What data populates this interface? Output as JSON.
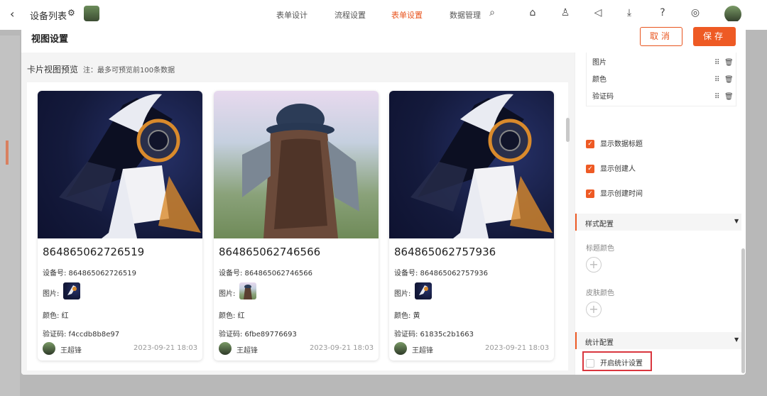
{
  "app": {
    "back_icon": "chevron-left-icon",
    "title": "设备列表",
    "nav": [
      "表单设计",
      "流程设置",
      "表单设置",
      "数据管理"
    ],
    "active_nav": "表单设置",
    "toolbar_icons": [
      "search-icon",
      "home-icon",
      "shirt-icon",
      "megaphone-icon",
      "download-icon",
      "help-icon",
      "settings-icon"
    ]
  },
  "dialog": {
    "title": "视图设置",
    "cancel_label": "取消",
    "save_label": "保存",
    "preview_title": "卡片视图预览",
    "preview_note": "注：最多可预览前100条数据",
    "cards": [
      {
        "title": "864865062726519",
        "device_no": "设备号: 864865062726519",
        "image_label": "图片:",
        "color": "颜色: 红",
        "code": "验证码: f4ccdb8b8e97",
        "user": "王超锋",
        "time": "2023-09-21 18:03"
      },
      {
        "title": "864865062746566",
        "device_no": "设备号: 864865062746566",
        "image_label": "图片:",
        "color": "颜色: 红",
        "code": "验证码: 6fbe89776693",
        "user": "王超锋",
        "time": "2023-09-21 18:03"
      },
      {
        "title": "864865062757936",
        "device_no": "设备号: 864865062757936",
        "image_label": "图片:",
        "color": "颜色: 黄",
        "code": "验证码: 61835c2b1663",
        "user": "王超锋",
        "time": "2023-09-21 18:03"
      }
    ],
    "fields": [
      "图片",
      "颜色",
      "验证码"
    ],
    "checks": [
      {
        "label": "显示数据标题",
        "checked": true
      },
      {
        "label": "显示创建人",
        "checked": true
      },
      {
        "label": "显示创建时间",
        "checked": true
      }
    ],
    "style_section": "样式配置",
    "title_color_label": "标题颜色",
    "skin_color_label": "皮肤颜色",
    "stats_section": "统计配置",
    "stats_toggle": {
      "label": "开启统计设置",
      "checked": false
    }
  },
  "colors": {
    "accent": "#ee5a24",
    "highlight": "#d9363e"
  }
}
